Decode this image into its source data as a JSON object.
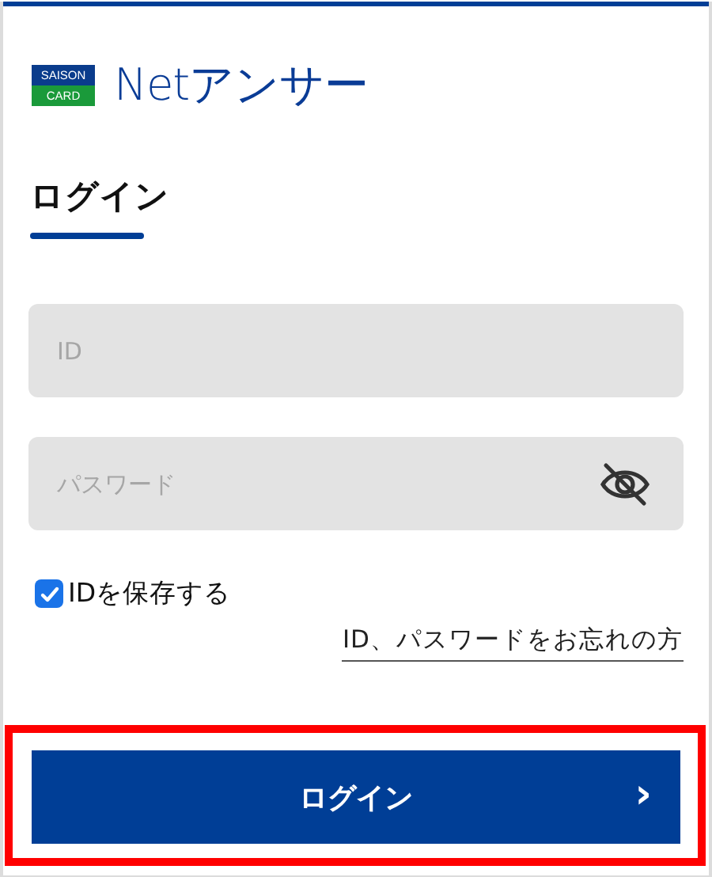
{
  "logo": {
    "top": "SAISON",
    "bottom": "CARD",
    "service": "Netアンサー"
  },
  "heading": "ログイン",
  "fields": [
    {
      "kind": "text",
      "placeholder": "ID"
    },
    {
      "kind": "password",
      "placeholder": "パスワード"
    }
  ],
  "save_id": {
    "label": "IDを保存する",
    "checked": true
  },
  "forgot_link": "ID、パスワードをお忘れの方",
  "login_button": {
    "label": "ログイン",
    "arrow": "›"
  }
}
